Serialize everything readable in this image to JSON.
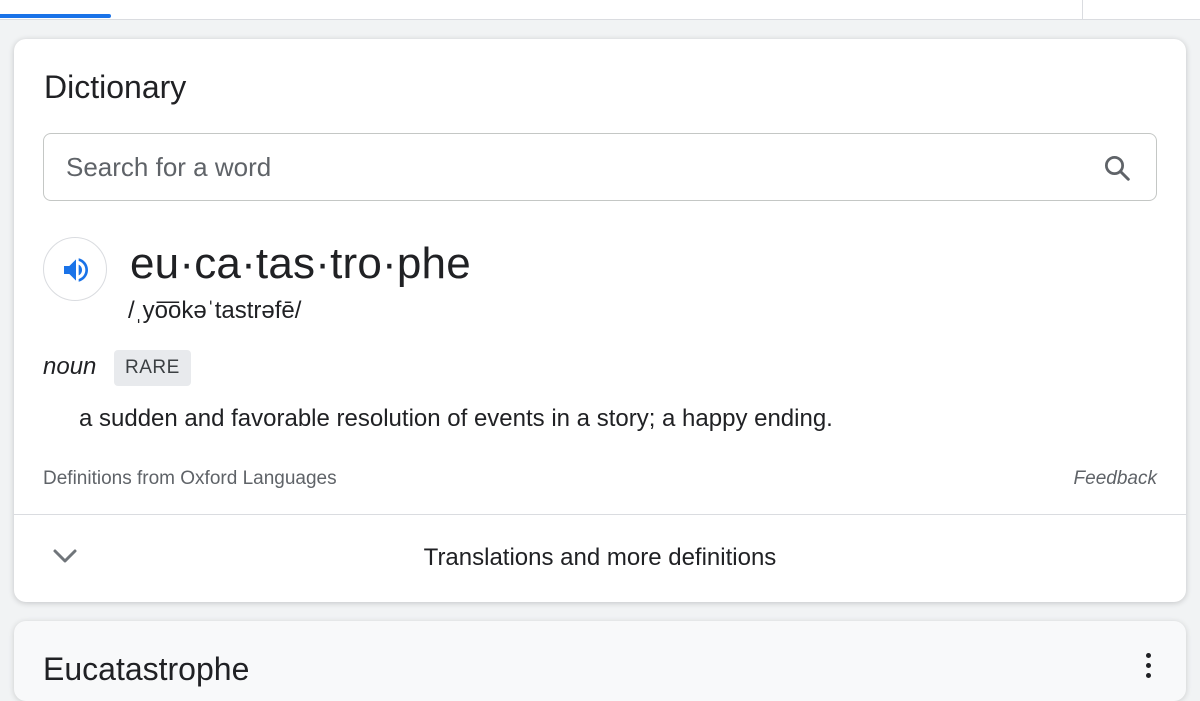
{
  "dictionary": {
    "title": "Dictionary",
    "search": {
      "placeholder": "Search for a word",
      "value": ""
    },
    "entry": {
      "headword": "eu·ca·tas·tro·phe",
      "phonetic": "/ˌyo͞okəˈtastrəfē/",
      "part_of_speech": "noun",
      "label": "RARE",
      "definition": "a sudden and favorable resolution of events in a story; a happy ending."
    },
    "source": "Definitions from Oxford Languages",
    "feedback": "Feedback",
    "expander": "Translations and more definitions"
  },
  "next_result": {
    "title": "Eucatastrophe"
  },
  "icons": {
    "search": "search-icon",
    "speaker": "speaker-icon",
    "chevron": "chevron-down-icon",
    "more": "more-vert-icon"
  },
  "colors": {
    "accent": "#1a73e8",
    "text": "#202124",
    "muted": "#5f6368"
  }
}
